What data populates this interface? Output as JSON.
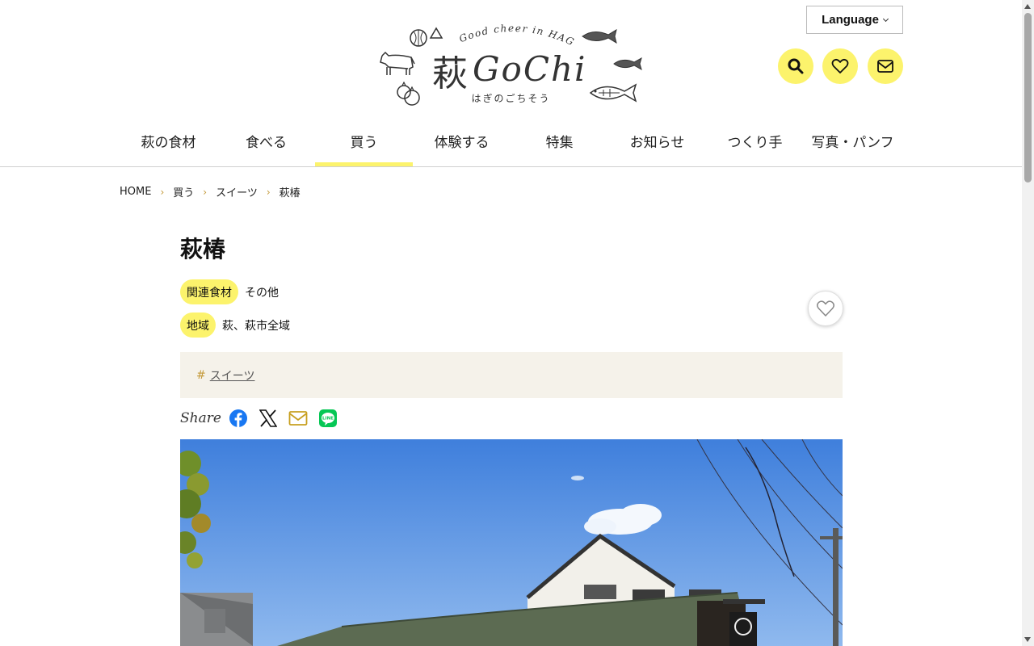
{
  "header": {
    "language_label": "Language",
    "logo": {
      "tagline": "Good cheer in HAGI",
      "kanji": "萩",
      "latin": "GoChi",
      "subtitle": "はぎのごちそう"
    },
    "icons": [
      "search-icon",
      "heart-icon",
      "mail-icon"
    ],
    "accent_color": "#fcf36c"
  },
  "nav": {
    "items": [
      {
        "label": "萩の食材"
      },
      {
        "label": "食べる"
      },
      {
        "label": "買う"
      },
      {
        "label": "体験する"
      },
      {
        "label": "特集"
      },
      {
        "label": "お知らせ"
      },
      {
        "label": "つくり手"
      },
      {
        "label": "写真・パンフ"
      }
    ],
    "active_index": 2
  },
  "breadcrumb": {
    "items": [
      "HOME",
      "買う",
      "スイーツ",
      "萩椿"
    ]
  },
  "article": {
    "title": "萩椿",
    "meta": [
      {
        "label": "関連食材",
        "value": "その他"
      },
      {
        "label": "地域",
        "value": "萩、萩市全域"
      }
    ],
    "tag_hash": "#",
    "tags": [
      "スイーツ"
    ],
    "share_label": "Share",
    "share_icons": [
      "facebook-icon",
      "x-icon",
      "mail-icon",
      "line-icon"
    ],
    "brand_colors": {
      "facebook": "#1877f2",
      "line": "#06c755",
      "mail": "#c8a020"
    }
  }
}
